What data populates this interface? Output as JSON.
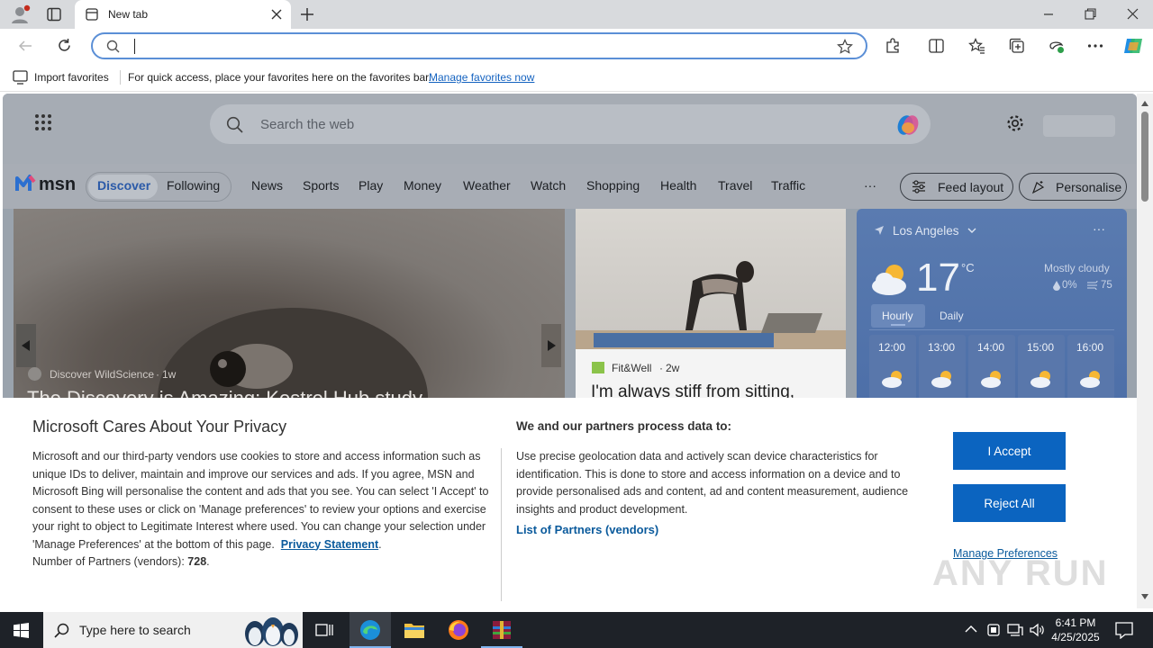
{
  "browser": {
    "tab_title": "New tab",
    "address_value": ""
  },
  "favbar": {
    "import_label": "Import favorites",
    "hint": "For quick access, place your favorites here on the favorites bar.",
    "manage_link": "Manage favorites now"
  },
  "msn": {
    "search_placeholder": "Search the web",
    "logo_text": "msn",
    "nav": {
      "discover": "Discover",
      "following": "Following",
      "items": [
        "News",
        "Sports",
        "Play",
        "Money",
        "Weather",
        "Watch",
        "Shopping",
        "Health",
        "Travel",
        "Traffic"
      ],
      "more": "···",
      "feed_layout": "Feed layout",
      "personalise": "Personalise"
    },
    "hero": {
      "source": "Discover WildScience",
      "age": "1w",
      "headline": "The Discovery is Amazing: Kestrel Hub study"
    },
    "card2": {
      "source": "Fit&Well",
      "age": "2w",
      "headline": "I'm always stiff from sitting,"
    },
    "weather": {
      "location": "Los Angeles",
      "temp": "17",
      "unit": "°C",
      "condition": "Mostly cloudy",
      "precip": "0%",
      "aqi": "75",
      "tab_hourly": "Hourly",
      "tab_daily": "Daily",
      "hours": [
        "12:00",
        "13:00",
        "14:00",
        "15:00",
        "16:00"
      ]
    }
  },
  "privacy": {
    "title": "Microsoft Cares About Your Privacy",
    "body": "Microsoft and our third-party vendors use cookies to store and access information such as unique IDs to deliver, maintain and improve our services and ads. If you agree, MSN and Microsoft Bing will personalise the content and ads that you see. You can select 'I Accept' to consent to these uses or click on 'Manage preferences' to review your options and exercise your right to object to Legitimate Interest where used.  You can change your selection under 'Manage Preferences' at the bottom of this page.",
    "privacy_link": "Privacy Statement",
    "partners_label": "Number of Partners (vendors):",
    "partners_count": "728",
    "purposes_title": "We and our partners process data to:",
    "purposes_text": "Use precise geolocation data and actively scan device characteristics for identification. This is done to store and access information on a device and to provide personalised ads and content, ad and content measurement, audience insights and product development.",
    "partners_link": "List of Partners (vendors)",
    "accept": "I Accept",
    "reject": "Reject All",
    "manage": "Manage Preferences"
  },
  "taskbar": {
    "search_placeholder": "Type here to search",
    "time": "6:41 PM",
    "date": "4/25/2025"
  },
  "watermark": "ANY RUN"
}
